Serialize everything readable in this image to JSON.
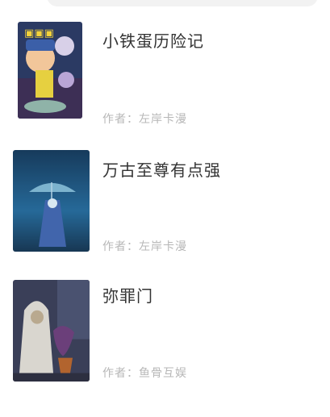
{
  "search": {
    "placeholder": ""
  },
  "books": [
    {
      "title": "小铁蛋历险记",
      "author": "作者：左岸卡漫"
    },
    {
      "title": "万古至尊有点强",
      "author": "作者：左岸卡漫"
    },
    {
      "title": "弥罪门",
      "author": "作者：鱼骨互娱"
    }
  ],
  "colors": {
    "title": "#333333",
    "author": "#b7b7b7",
    "search_bg": "#f2f2f2"
  }
}
